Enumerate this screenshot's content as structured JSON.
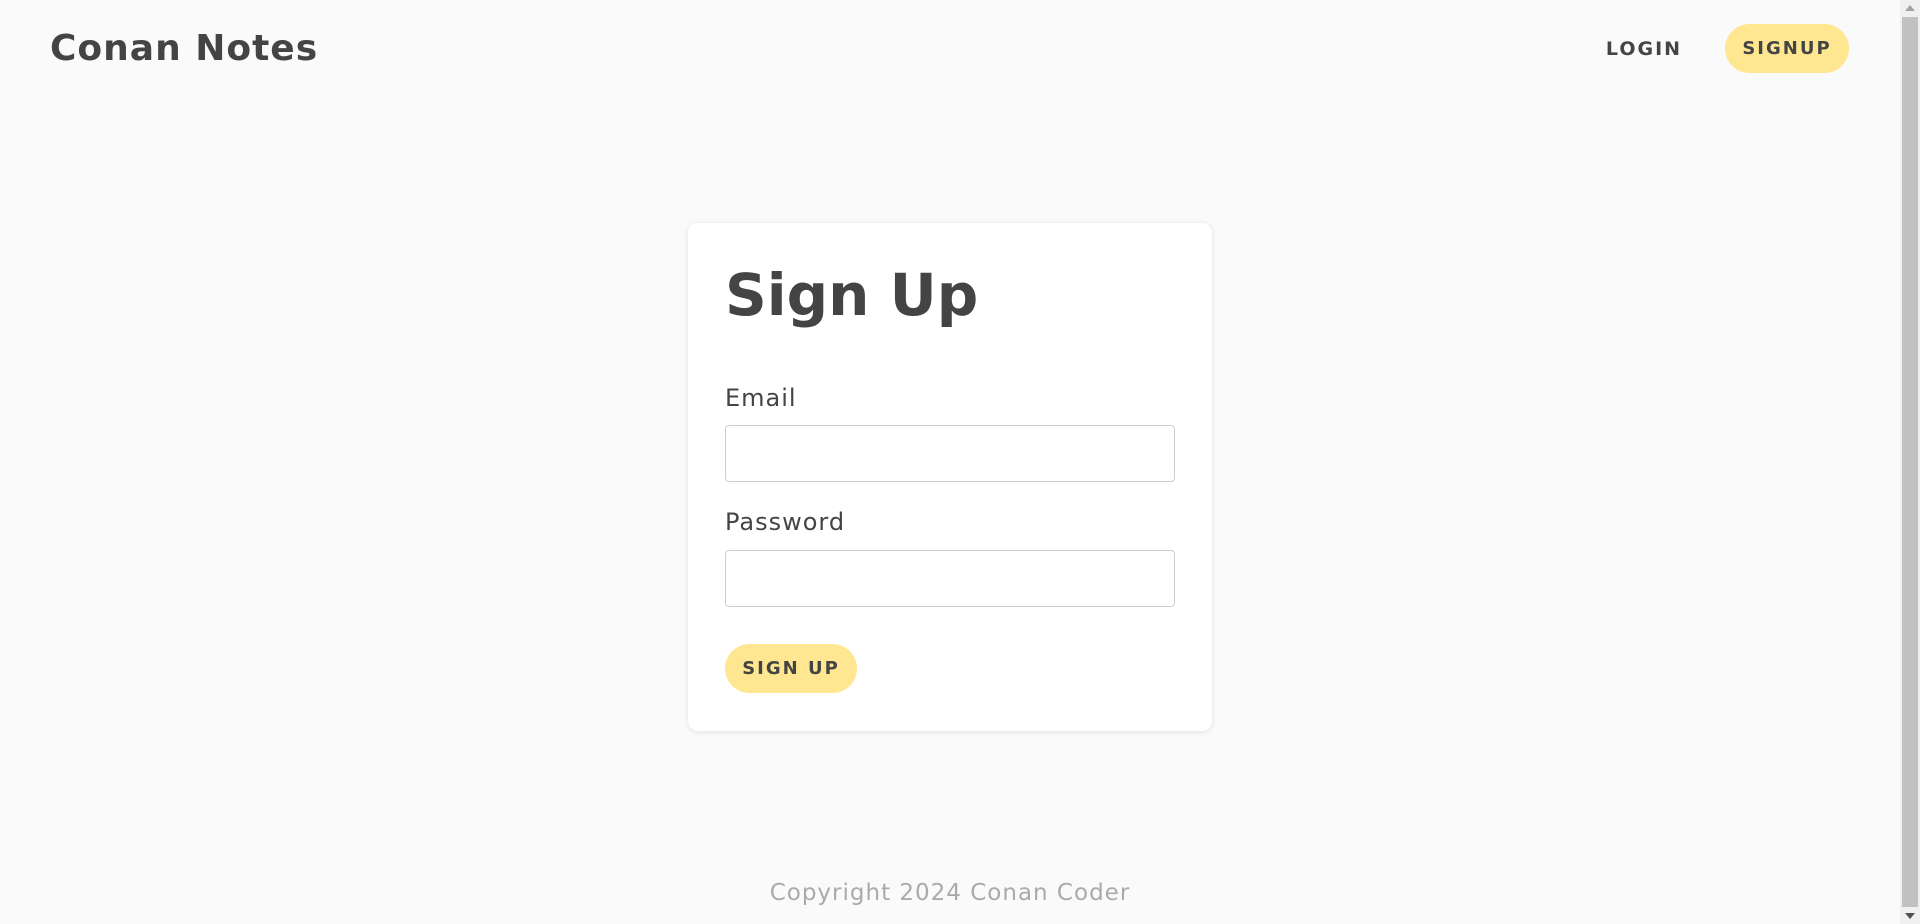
{
  "header": {
    "brand": "Conan Notes",
    "nav": {
      "login_label": "LOGIN",
      "signup_label": "SIGNUP"
    }
  },
  "form": {
    "title": "Sign Up",
    "email": {
      "label": "Email",
      "value": "",
      "placeholder": ""
    },
    "password": {
      "label": "Password",
      "value": "",
      "placeholder": ""
    },
    "submit_label": "SIGN UP"
  },
  "footer": {
    "copyright": "Copyright 2024 Conan Coder"
  },
  "colors": {
    "background": "#fafafa",
    "card": "#ffffff",
    "accent": "#ffe791",
    "text": "#444444",
    "muted": "#aaaaaa"
  }
}
